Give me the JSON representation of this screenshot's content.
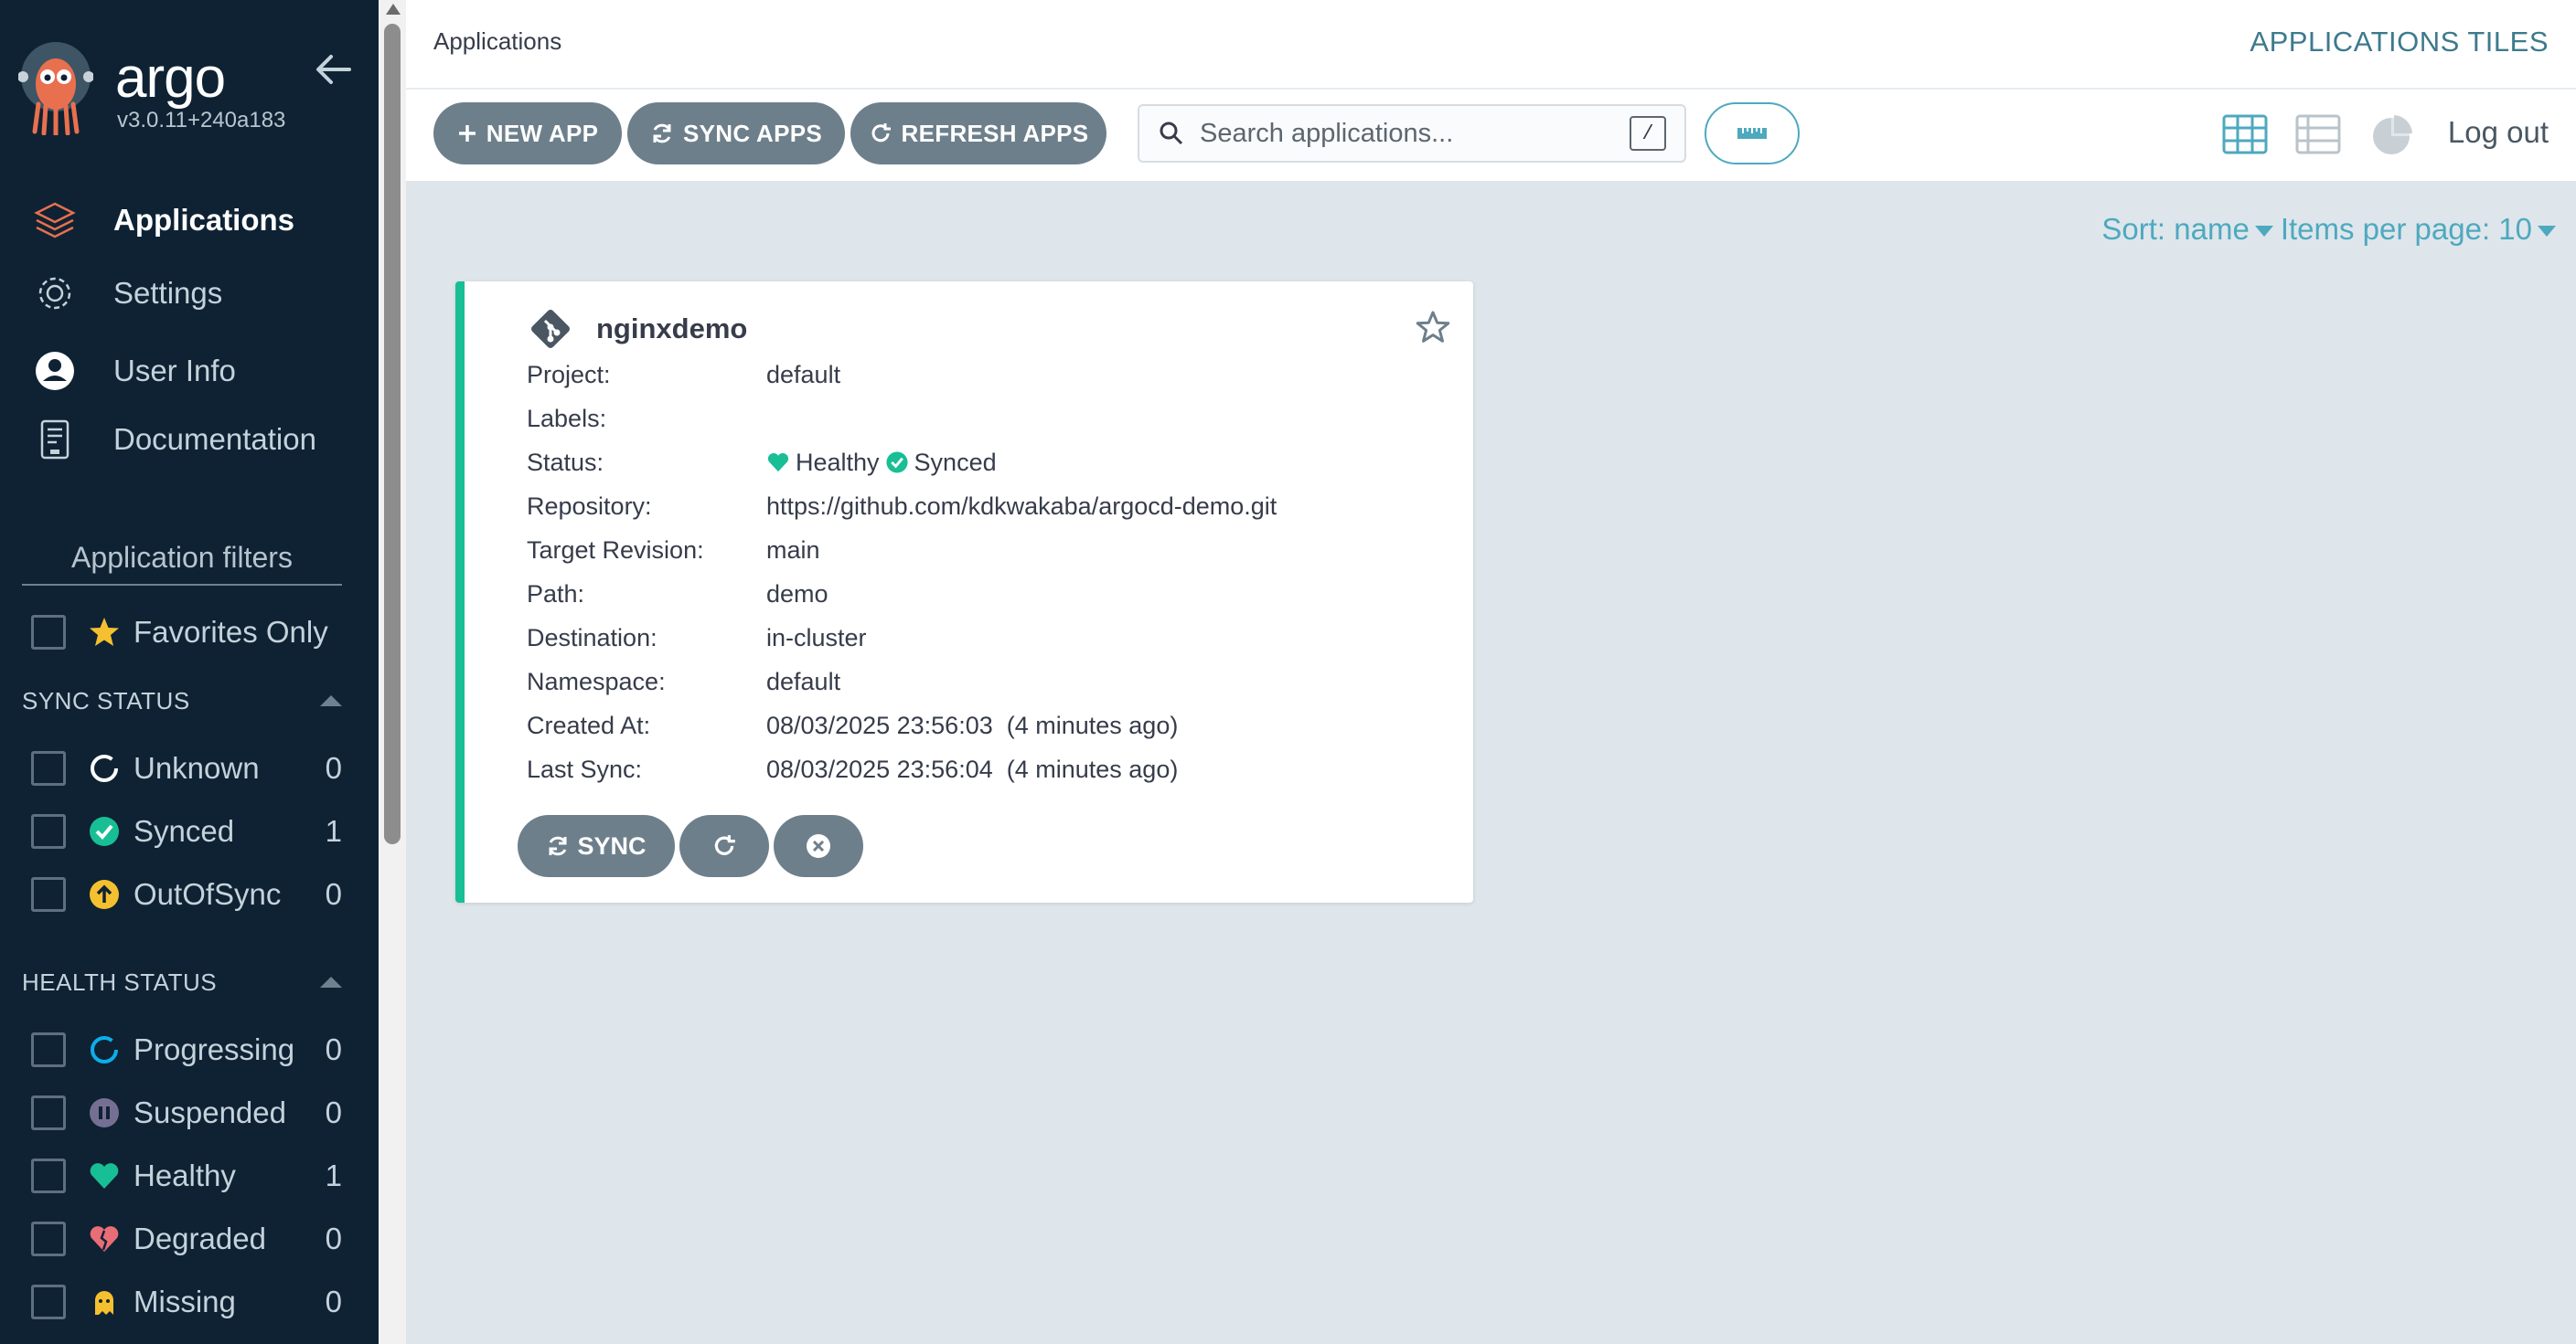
{
  "sidebar": {
    "brand_name": "argo",
    "version": "v3.0.11+240a183",
    "nav": [
      {
        "label": "Applications",
        "icon": "stack-layers-icon",
        "active": true
      },
      {
        "label": "Settings",
        "icon": "gear-icon",
        "active": false
      },
      {
        "label": "User Info",
        "icon": "user-circle-icon",
        "active": false
      },
      {
        "label": "Documentation",
        "icon": "document-icon",
        "active": false
      }
    ],
    "filters_title": "Application filters",
    "favorites_label": "Favorites Only",
    "sync_status": {
      "title": "SYNC STATUS",
      "items": [
        {
          "label": "Unknown",
          "count": "0",
          "icon": "unknown-ring-icon",
          "color": "#ffffff"
        },
        {
          "label": "Synced",
          "count": "1",
          "icon": "check-circle-icon",
          "color": "#18be94"
        },
        {
          "label": "OutOfSync",
          "count": "0",
          "icon": "arrow-up-circle-icon",
          "color": "#f4c030"
        }
      ]
    },
    "health_status": {
      "title": "HEALTH STATUS",
      "items": [
        {
          "label": "Progressing",
          "count": "0",
          "icon": "progress-ring-icon",
          "color": "#0dadea"
        },
        {
          "label": "Suspended",
          "count": "0",
          "icon": "pause-circle-icon",
          "color": "#766f94"
        },
        {
          "label": "Healthy",
          "count": "1",
          "icon": "heart-icon",
          "color": "#18be94"
        },
        {
          "label": "Degraded",
          "count": "0",
          "icon": "broken-heart-icon",
          "color": "#e96d76"
        },
        {
          "label": "Missing",
          "count": "0",
          "icon": "ghost-icon",
          "color": "#f4c030"
        }
      ]
    }
  },
  "topbar": {
    "breadcrumb": "Applications",
    "title": "APPLICATIONS TILES",
    "logout": "Log out"
  },
  "toolbar": {
    "new_app": "NEW APP",
    "sync_apps": "SYNC APPS",
    "refresh_apps": "REFRESH APPS",
    "search_placeholder": "Search applications...",
    "search_value": "",
    "search_shortcut": "/"
  },
  "sort": {
    "sort_label": "Sort: name",
    "items_label": "Items per page: 10"
  },
  "app_card": {
    "name": "nginxdemo",
    "fields": [
      {
        "label": "Project:",
        "value": "default"
      },
      {
        "label": "Labels:",
        "value": ""
      },
      {
        "label": "Status:",
        "value": ""
      },
      {
        "label": "Repository:",
        "value": "https://github.com/kdkwakaba/argocd-demo.git"
      },
      {
        "label": "Target Revision:",
        "value": "main"
      },
      {
        "label": "Path:",
        "value": "demo"
      },
      {
        "label": "Destination:",
        "value": "in-cluster"
      },
      {
        "label": "Namespace:",
        "value": "default"
      },
      {
        "label": "Created At:",
        "value": "08/03/2025 23:56:03  (4 minutes ago)"
      },
      {
        "label": "Last Sync:",
        "value": "08/03/2025 23:56:04  (4 minutes ago)"
      }
    ],
    "health": "Healthy",
    "sync": "Synced",
    "sync_button": "SYNC",
    "accent_color": "#18be94"
  },
  "colors": {
    "sidebar_bg": "#0e2233",
    "content_bg": "#dee6eb",
    "button_gray": "#6d7f8b",
    "accent_teal": "#4ea9bf"
  }
}
